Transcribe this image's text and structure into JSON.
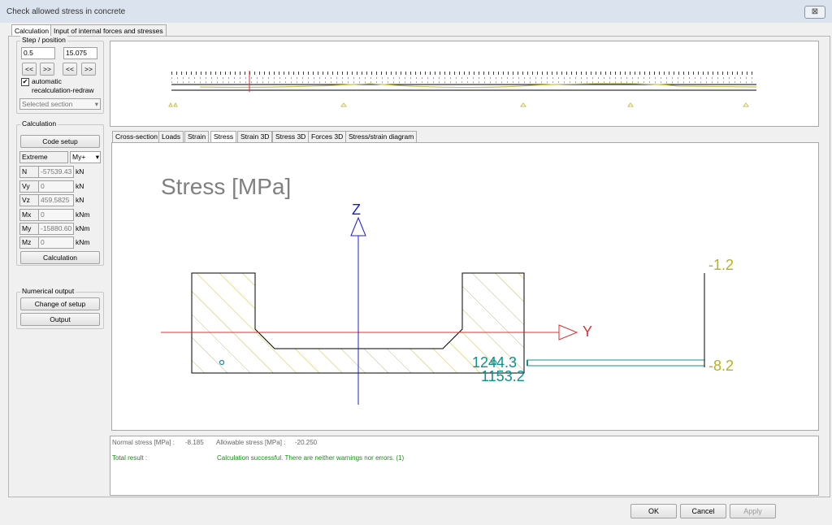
{
  "window": {
    "title": "Check allowed stress in concrete",
    "close": "⊠"
  },
  "tabs": [
    "Calculation",
    "Input of internal forces and stresses"
  ],
  "step_position": {
    "label": "Step / position",
    "step": "0.5",
    "position": "15.075",
    "nav_buttons": [
      "<<",
      ">>",
      "<<",
      ">>"
    ],
    "auto_checkbox_mark": "✔",
    "auto_label_line1": "automatic",
    "auto_label_line2": "recalculation-redraw",
    "section_select": "Selected section"
  },
  "calculation": {
    "label": "Calculation",
    "code_setup": "Code setup",
    "extreme_label": "Extreme",
    "extreme_value": "My+",
    "forces": [
      {
        "name": "N",
        "value": "-57539.43",
        "unit": "kN"
      },
      {
        "name": "Vy",
        "value": "0",
        "unit": "kN"
      },
      {
        "name": "Vz",
        "value": "459.5825",
        "unit": "kN"
      },
      {
        "name": "Mx",
        "value": "0",
        "unit": "kNm"
      },
      {
        "name": "My",
        "value": "-15880.60",
        "unit": "kNm"
      },
      {
        "name": "Mz",
        "value": "0",
        "unit": "kNm"
      }
    ],
    "button": "Calculation"
  },
  "numerical_output": {
    "label": "Numerical output",
    "change_setup": "Change of setup",
    "output": "Output"
  },
  "sub_tabs": [
    "Cross-section",
    "Loads",
    "Strain",
    "Stress",
    "Strain 3D",
    "Stress 3D",
    "Forces 3D",
    "Stress/strain diagram"
  ],
  "diagram": {
    "title": "Stress [MPa]",
    "axis_z": "Z",
    "axis_y": "Y",
    "stress_top": "-1.2",
    "stress_bottom": "-8.2",
    "point_label_1": "1244.3",
    "point_label_2": "1153.2",
    "colors": {
      "hatch": "#c8c050",
      "axis_z": "#1c1cd8",
      "axis_y": "#e03030",
      "label_teal": "#108f8f",
      "stress_yellow": "#b8b020"
    }
  },
  "results": {
    "normal_stress_label": "Normal stress [MPa] :",
    "normal_stress_value": "-8.185",
    "allowable_stress_label": "Allowable stress [MPa] :",
    "allowable_stress_value": "-20.250",
    "total_result_label": "Total result :",
    "total_result_value": "Calculation successful. There are neither warnings nor errors. (1)"
  },
  "footer": {
    "ok": "OK",
    "cancel": "Cancel",
    "apply": "Apply"
  }
}
